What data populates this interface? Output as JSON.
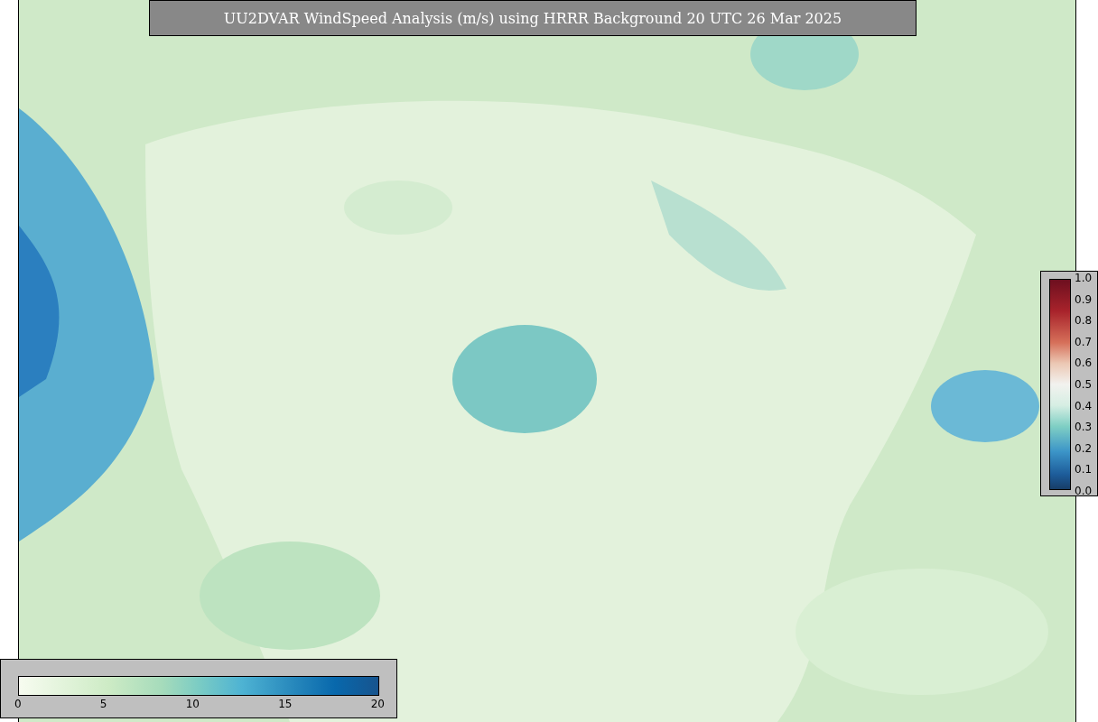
{
  "title": "UU2DVAR WindSpeed Analysis (m/s) using HRRR Background 20 UTC 26 Mar 2025",
  "colorbars": [
    {
      "kind": "vertical",
      "ticks": [
        "1.0",
        "0.9",
        "0.8",
        "0.7",
        "0.6",
        "0.5",
        "0.4",
        "0.3",
        "0.2",
        "0.1",
        "0.0"
      ]
    },
    {
      "kind": "horizontal",
      "ticks": [
        "0",
        "5",
        "10",
        "15",
        "20"
      ]
    }
  ]
}
